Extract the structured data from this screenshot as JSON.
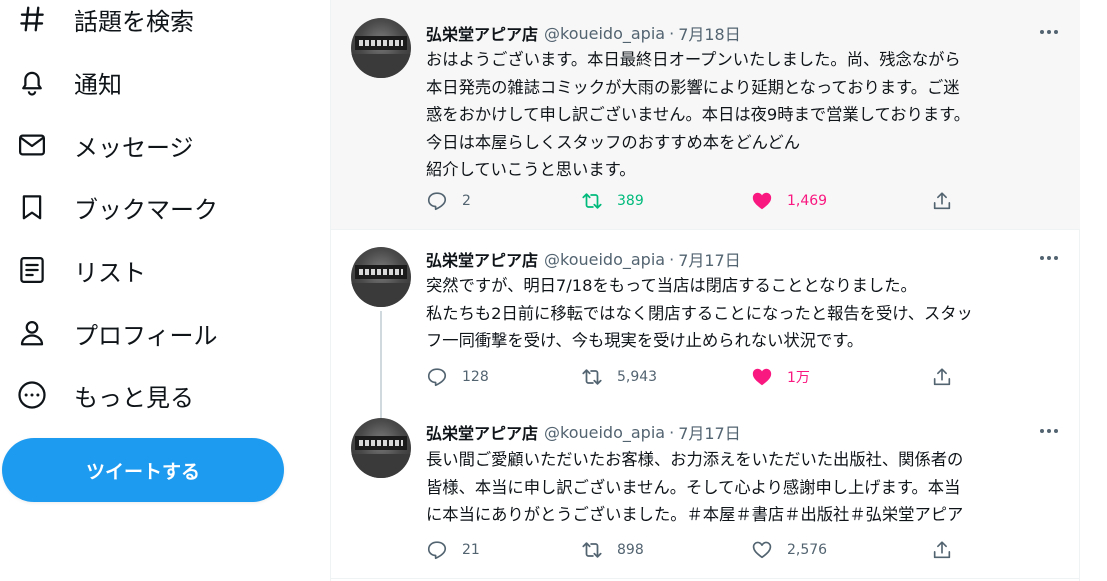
{
  "sidebar": {
    "items": [
      {
        "label": "話題を検索",
        "icon": "hashtag-icon"
      },
      {
        "label": "通知",
        "icon": "bell-icon"
      },
      {
        "label": "メッセージ",
        "icon": "mail-icon"
      },
      {
        "label": "ブックマーク",
        "icon": "bookmark-icon"
      },
      {
        "label": "リスト",
        "icon": "list-icon"
      },
      {
        "label": "プロフィール",
        "icon": "profile-icon"
      },
      {
        "label": "もっと見る",
        "icon": "more-circle-icon"
      }
    ],
    "tweet_button": "ツイートする"
  },
  "colors": {
    "accent": "#1d9bf0",
    "retweet_active": "#00ba7c",
    "like_active": "#f91880",
    "muted": "#536471"
  },
  "tweets": [
    {
      "name": "弘栄堂アピア店",
      "handle": "@koueido_apia",
      "separator": "·",
      "date": "7月18日",
      "text": "おはようございます。本日最終日オープンいたしました。尚、残念ながら\n本日発売の雑誌コミックが大雨の影響により延期となっております。ご迷\n惑をおかけして申し訳ございません。本日は夜9時まで営業しております。\n今日は本屋らしくスタッフのおすすめ本をどんどん\n紹介していこうと思います。",
      "replies": "2",
      "retweets": "389",
      "likes": "1,469",
      "retweeted": true,
      "liked": true
    },
    {
      "name": "弘栄堂アピア店",
      "handle": "@koueido_apia",
      "separator": "·",
      "date": "7月17日",
      "text": "突然ですが、明日7/18をもって当店は閉店することとなりました。\n私たちも2日前に移転ではなく閉店することになったと報告を受け、スタッ\nフ一同衝撃を受け、今も現実を受け止められない状況です。",
      "replies": "128",
      "retweets": "5,943",
      "likes": "1万",
      "retweeted": false,
      "liked": true
    },
    {
      "name": "弘栄堂アピア店",
      "handle": "@koueido_apia",
      "separator": "·",
      "date": "7月17日",
      "text": "長い間ご愛顧いただいたお客様、お力添えをいただいた出版社、関係者の\n皆様、本当に申し訳ございません。そして心より感謝申し上げます。本当\nに本当にありがとうございました。＃本屋＃書店＃出版社＃弘栄堂アピア",
      "replies": "21",
      "retweets": "898",
      "likes": "2,576",
      "retweeted": false,
      "liked": false
    }
  ]
}
